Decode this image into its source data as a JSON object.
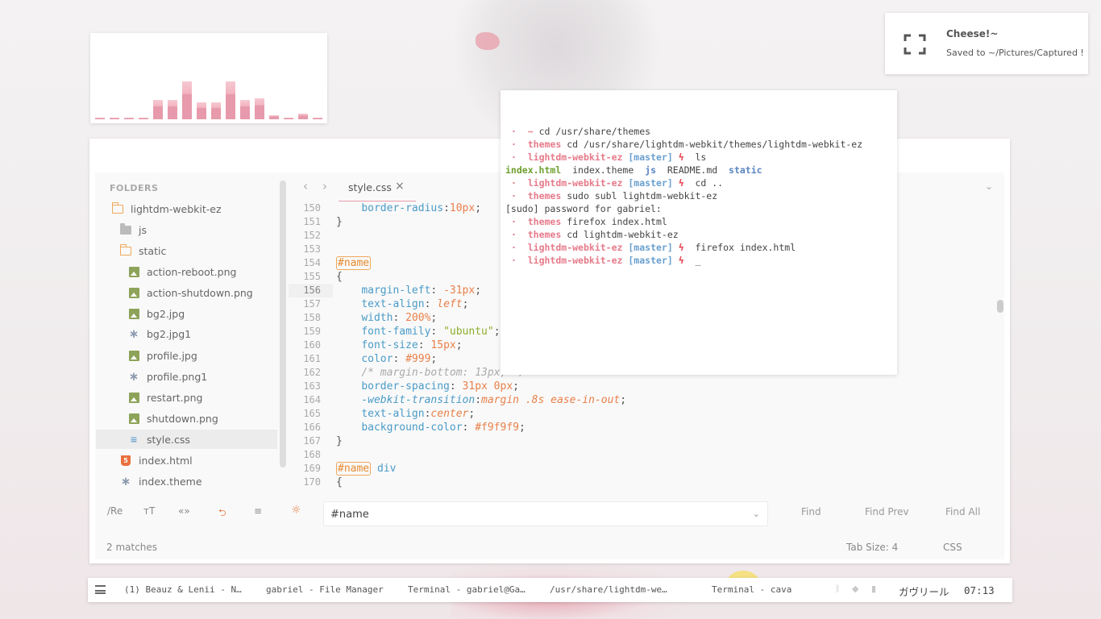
{
  "cava": {
    "levels": [
      0.02,
      0.04,
      0.02,
      0.02,
      0.5,
      0.5,
      1.0,
      0.45,
      0.45,
      1.0,
      0.5,
      0.55,
      0.1,
      0.04,
      0.14,
      0.04
    ]
  },
  "notification": {
    "title": "Cheese!~",
    "message": "Saved to ~/Pictures/Captured !",
    "icon": "fullscreen-icon"
  },
  "editor": {
    "sidebar": {
      "heading": "FOLDERS",
      "items": [
        {
          "label": "lightdm-webkit-ez",
          "icon": "folder-open-icon"
        },
        {
          "label": "js",
          "icon": "folder-icon"
        },
        {
          "label": "static",
          "icon": "folder-open-icon"
        },
        {
          "label": "action-reboot.png",
          "icon": "image-icon"
        },
        {
          "label": "action-shutdown.png",
          "icon": "image-icon"
        },
        {
          "label": "bg2.jpg",
          "icon": "image-icon"
        },
        {
          "label": "bg2.jpg1",
          "icon": "asterisk-icon"
        },
        {
          "label": "profile.jpg",
          "icon": "image-icon"
        },
        {
          "label": "profile.png1",
          "icon": "asterisk-icon"
        },
        {
          "label": "restart.png",
          "icon": "image-icon"
        },
        {
          "label": "shutdown.png",
          "icon": "image-icon"
        },
        {
          "label": "style.css",
          "icon": "css-icon"
        },
        {
          "label": "index.html",
          "icon": "html-icon"
        },
        {
          "label": "index.theme",
          "icon": "asterisk-icon"
        }
      ]
    },
    "tab": {
      "label": "style.css",
      "close": "×"
    },
    "nav": {
      "back": "‹",
      "forward": "›",
      "dropdown": "⌄"
    },
    "line_numbers": [
      "150",
      "151",
      "152",
      "153",
      "154",
      "155",
      "156",
      "157",
      "158",
      "159",
      "160",
      "161",
      "162",
      "163",
      "164",
      "165",
      "166",
      "167",
      "168",
      "169",
      "170"
    ],
    "current_line": "156",
    "code": {
      "l150_prop": "border-radius",
      "l150_val": "10px",
      "l151": "}",
      "l154_sel": "#name",
      "l155": "{",
      "l156_prop": "margin-left",
      "l156_val": "-31px",
      "l157_prop": "text-align",
      "l157_val": "left",
      "l158_prop": "width",
      "l158_val": "200%",
      "l159_prop": "font-family",
      "l159_val": "\"ubuntu\"",
      "l160_prop": "font-size",
      "l160_val": "15px",
      "l161_prop": "color",
      "l161_val": "#999",
      "l162_comment": "/* margin-bottom: 13px; */",
      "l163_prop": "border-spacing",
      "l163_val": "31px 0px",
      "l164_prop": "-webkit-transition",
      "l164_val": "margin .8s ease-in-out",
      "l165_prop": "text-align",
      "l165_val": "center",
      "l166_prop": "background-color",
      "l166_val": "#f9f9f9",
      "l167": "}",
      "l169_sel": "#name",
      "l169_tag": "div",
      "l170": "{"
    },
    "findbar": {
      "regex": "/Re",
      "case": "ᴛT",
      "word": "«»",
      "wrap": "⮌",
      "selection": "≡",
      "highlight": "☼",
      "query": "#name",
      "find": "Find",
      "find_prev": "Find Prev",
      "find_all": "Find All"
    },
    "status": {
      "matches": "2 matches",
      "tab_size": "Tab Size: 4",
      "syntax": "CSS"
    }
  },
  "terminal": {
    "lines": [
      {
        "dot": "·",
        "dir": "~",
        "cmd": " cd /usr/share/themes"
      },
      {
        "dot": "·",
        "dir": "themes",
        "cmd": " cd /usr/share/lightdm-webkit/themes/lightdm-webkit-ez"
      },
      {
        "dot": "·",
        "dir": "lightdm-webkit-ez",
        "branch": "[master]",
        "bolt": "ϟ",
        "cmd": "  ls"
      },
      {
        "ls": [
          "index.html",
          "index.theme",
          "js",
          "README.md",
          "static"
        ]
      },
      {
        "dot": "·",
        "dir": "lightdm-webkit-ez",
        "branch": "[master]",
        "bolt": "ϟ",
        "cmd": "  cd .."
      },
      {
        "dot": "·",
        "dir": "themes",
        "cmd": " sudo subl lightdm-webkit-ez"
      },
      {
        "text": "[sudo] password for gabriel:"
      },
      {
        "dot": "·",
        "dir": "themes",
        "cmd": " firefox index.html"
      },
      {
        "dot": "·",
        "dir": "themes",
        "cmd": " cd lightdm-webkit-ez"
      },
      {
        "dot": "·",
        "dir": "lightdm-webkit-ez",
        "branch": "[master]",
        "bolt": "ϟ",
        "cmd": "  firefox index.html"
      },
      {
        "dot": "·",
        "dir": "lightdm-webkit-ez",
        "branch": "[master]",
        "bolt": "ϟ",
        "cmd": "  _"
      }
    ]
  },
  "panel": {
    "tasks": [
      "(1) Beauz & Lenii - N…",
      "gabriel - File Manager",
      "Terminal - gabriel@Ga…",
      "/usr/share/lightdm-we…",
      "Terminal - cava"
    ],
    "tray": {
      "bluetooth": "ᛒ",
      "wifi": "◆",
      "battery": "▮"
    },
    "user": "ガヴリール",
    "time": "07:13"
  }
}
